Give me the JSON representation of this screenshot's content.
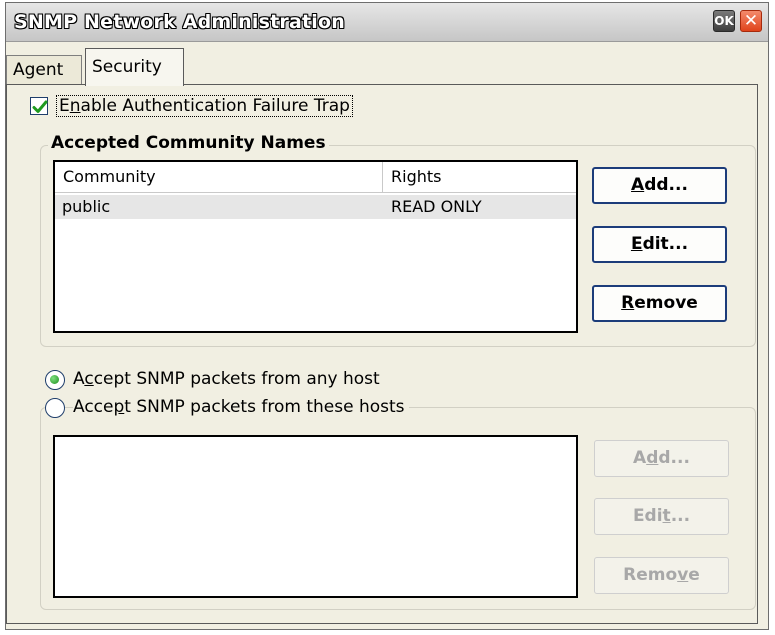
{
  "window": {
    "title": "SNMP Network Administration",
    "ok_label": "OK",
    "close_label": "✕"
  },
  "tabs": [
    {
      "label": "Agent",
      "selected": false
    },
    {
      "label": "Security",
      "selected": true
    }
  ],
  "security": {
    "auth_trap": {
      "checked": true,
      "label_parts": [
        "E",
        "n",
        "able Authentication Failure Trap"
      ]
    },
    "community_group": {
      "title": "Accepted Community Names",
      "columns": [
        "Community",
        "Rights"
      ],
      "rows": [
        {
          "community": "public",
          "rights": "READ ONLY"
        }
      ],
      "buttons": {
        "add": {
          "mnemonic": "A",
          "rest": "dd..."
        },
        "edit": {
          "mnemonic": "E",
          "rest": "dit..."
        },
        "remove": {
          "mnemonic": "R",
          "rest": "emove"
        }
      }
    },
    "hosts": {
      "any_host": {
        "selected": true,
        "pre": "A",
        "mnemonic": "c",
        "post": "cept SNMP packets from any host"
      },
      "these_hosts": {
        "selected": false,
        "pre": "Acce",
        "mnemonic": "p",
        "post": "t SNMP packets from these hosts"
      },
      "buttons": {
        "add": {
          "pre": "A",
          "mnemonic": "d",
          "post": "d..."
        },
        "edit": {
          "pre": "Edi",
          "mnemonic": "t",
          "post": "..."
        },
        "remove": {
          "pre": "Remo",
          "mnemonic": "v",
          "post": "e"
        }
      }
    }
  },
  "colors": {
    "window_bg": "#f1efe2",
    "accent_border": "#1c3c7a",
    "check_green": "#1f9a1f",
    "close_red": "#e0431b"
  }
}
